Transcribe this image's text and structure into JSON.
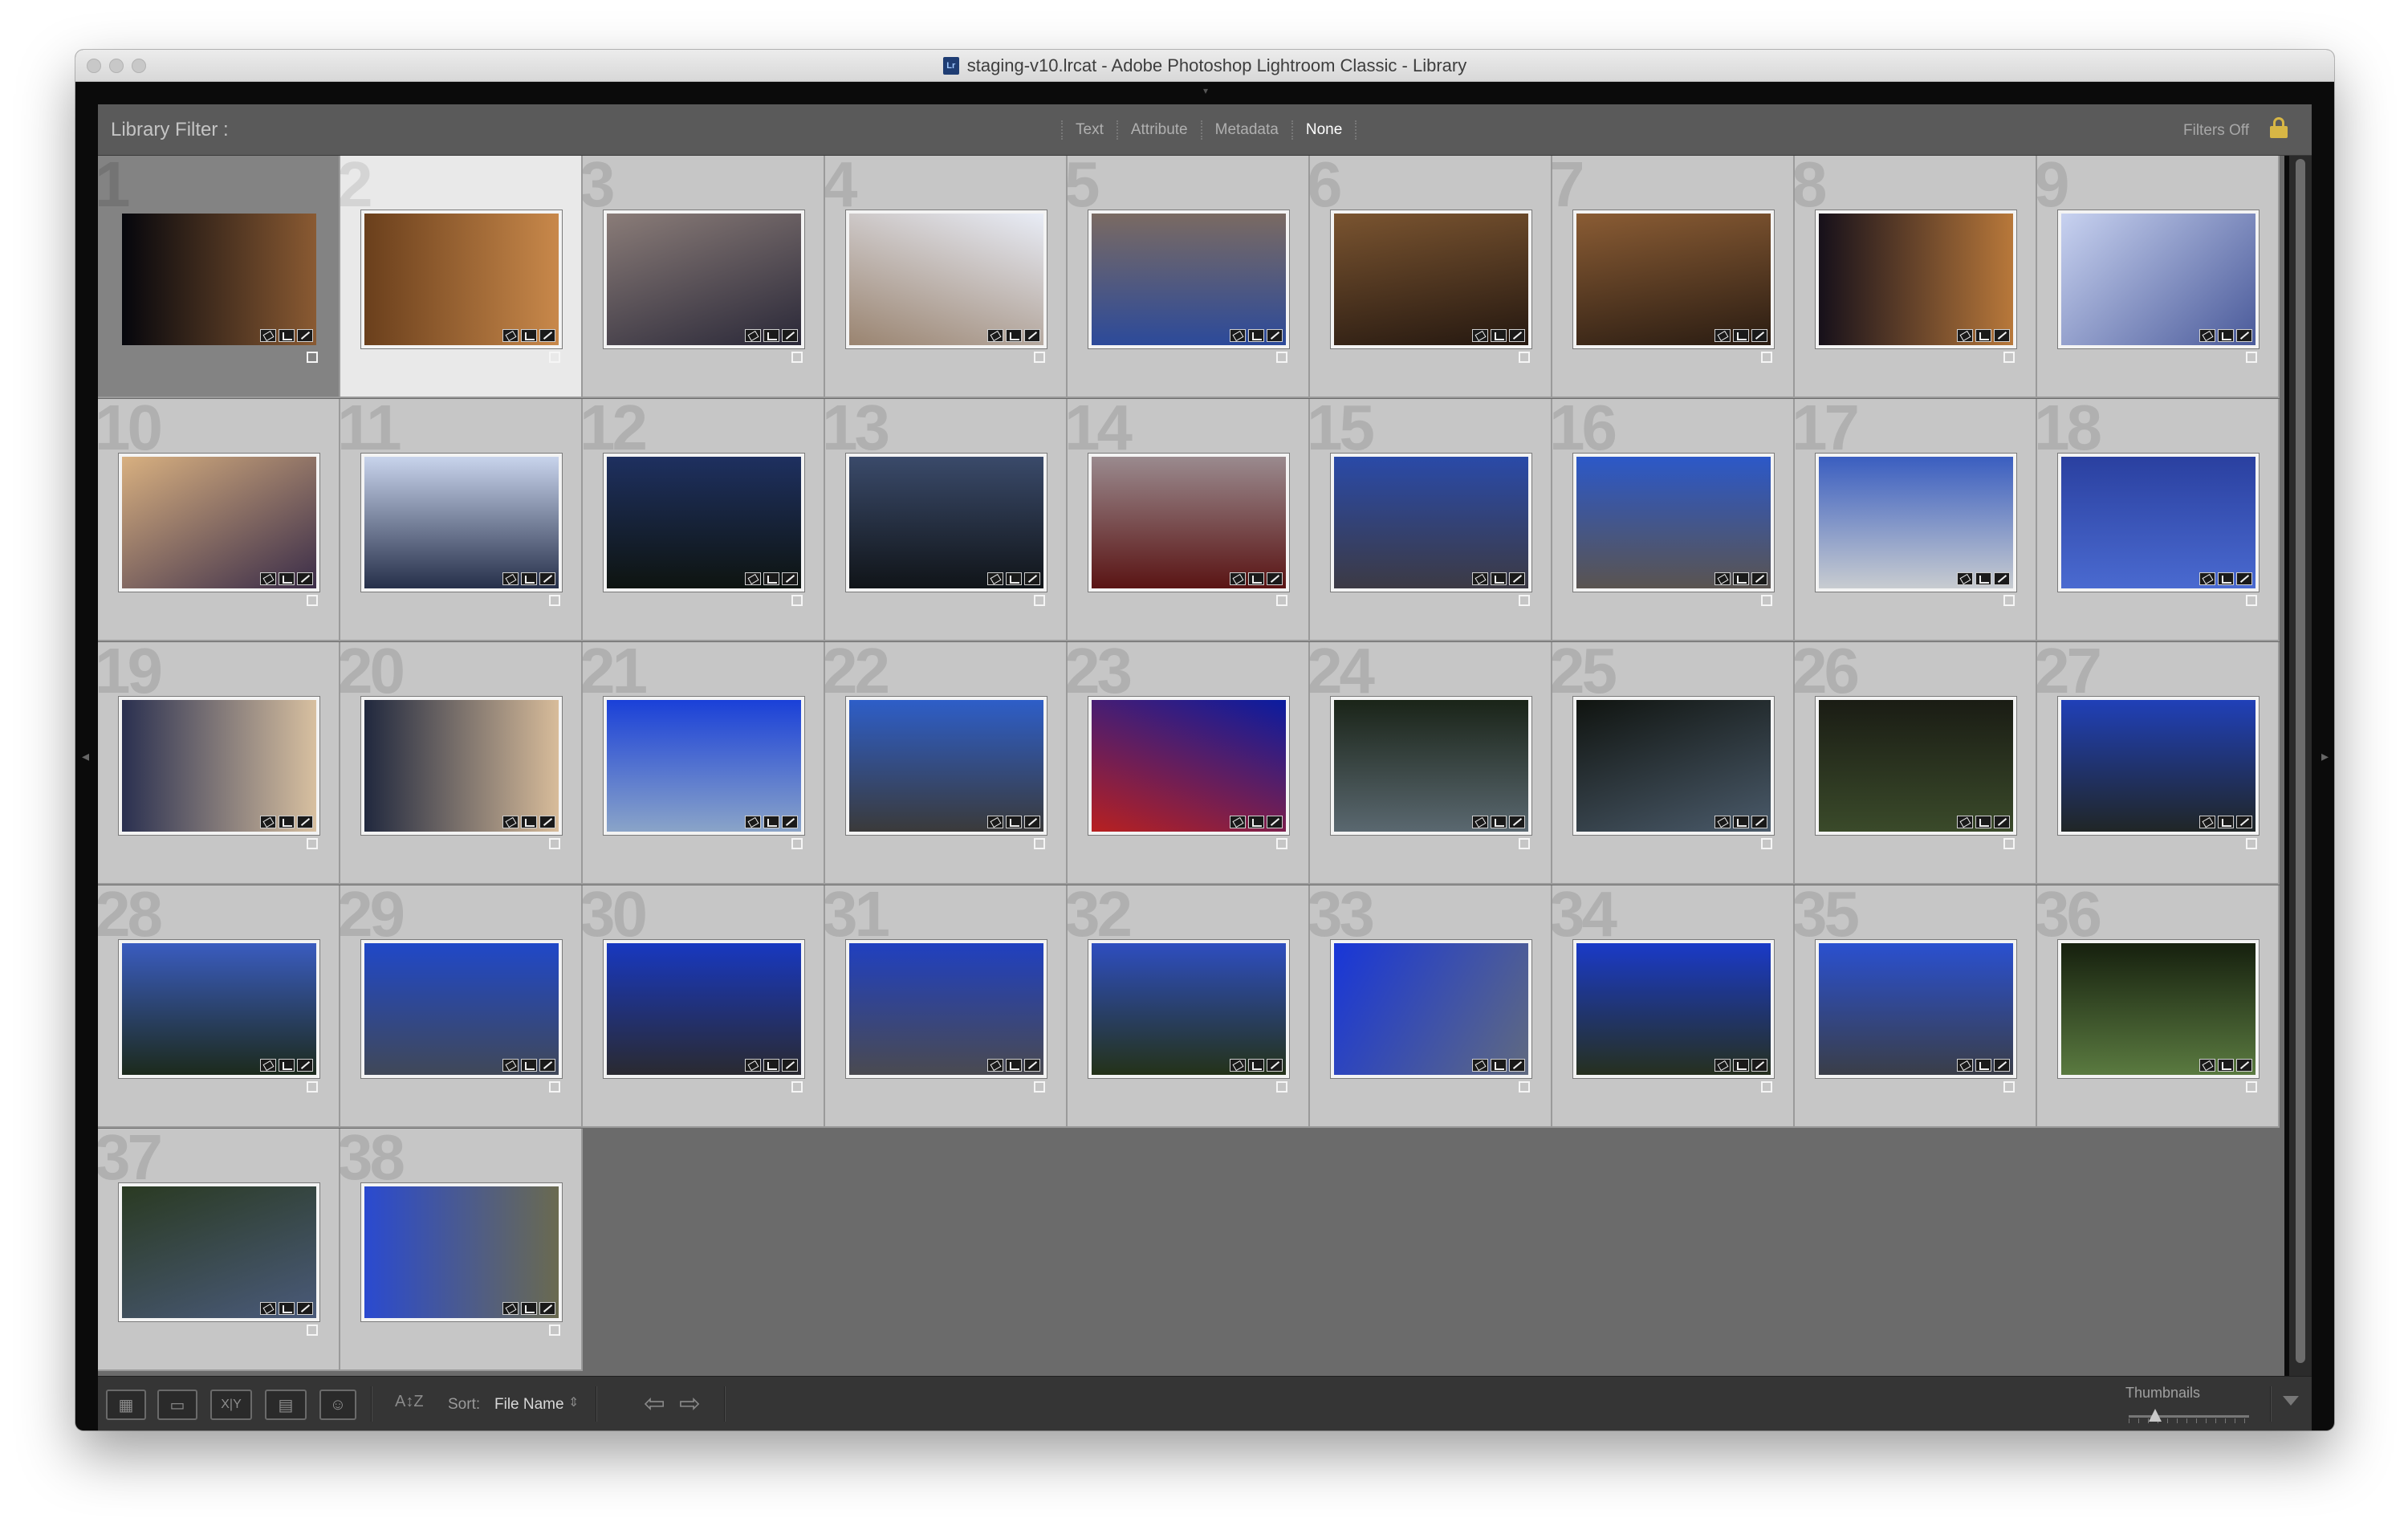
{
  "window": {
    "title": "staging-v10.lrcat - Adobe Photoshop Lightroom Classic - Library",
    "icon": "lightroom-catalog-icon",
    "doc_icon_text": "Lr"
  },
  "filter_bar": {
    "label": "Library Filter :",
    "tabs": [
      "Text",
      "Attribute",
      "Metadata",
      "None"
    ],
    "active_tab": "None",
    "filters_status": "Filters Off",
    "lock_icon": "lock-icon",
    "colors": {
      "lock": "#d7b645"
    }
  },
  "grid": {
    "selected_index": 2,
    "current_index": 1,
    "cells": [
      {
        "num": "1",
        "c1": "#05060c",
        "c2": "#8a5a32",
        "angle": 90
      },
      {
        "num": "2",
        "c1": "#6a3f1c",
        "c2": "#c8884a",
        "angle": 90
      },
      {
        "num": "3",
        "c1": "#8a7c78",
        "c2": "#2a2838",
        "angle": 160
      },
      {
        "num": "4",
        "c1": "#e8ecf6",
        "c2": "#9a8470",
        "angle": 200
      },
      {
        "num": "5",
        "c1": "#7a6a62",
        "c2": "#2c4a9a",
        "angle": 180
      },
      {
        "num": "6",
        "c1": "#7a5430",
        "c2": "#251810",
        "angle": 170
      },
      {
        "num": "7",
        "c1": "#8a5c34",
        "c2": "#2a1c12",
        "angle": 170
      },
      {
        "num": "8",
        "c1": "#16101a",
        "c2": "#b8783a",
        "angle": 90
      },
      {
        "num": "9",
        "c1": "#c8d2f0",
        "c2": "#4a5a9a",
        "angle": 135
      },
      {
        "num": "10",
        "c1": "#d8b080",
        "c2": "#3a2c48",
        "angle": 150
      },
      {
        "num": "11",
        "c1": "#c8d4ec",
        "c2": "#26304a",
        "angle": 180
      },
      {
        "num": "12",
        "c1": "#1e3060",
        "c2": "#0e1410",
        "angle": 180
      },
      {
        "num": "13",
        "c1": "#3a4a6a",
        "c2": "#101418",
        "angle": 180
      },
      {
        "num": "14",
        "c1": "#9a8a8e",
        "c2": "#5a1414",
        "angle": 180
      },
      {
        "num": "15",
        "c1": "#2a4aa8",
        "c2": "#3c3a44",
        "angle": 180
      },
      {
        "num": "16",
        "c1": "#2c58c8",
        "c2": "#5a5450",
        "angle": 180
      },
      {
        "num": "17",
        "c1": "#3a5ec0",
        "c2": "#c8ccd0",
        "angle": 180
      },
      {
        "num": "18",
        "c1": "#2a40a0",
        "c2": "#4a6ad0",
        "angle": 180
      },
      {
        "num": "19",
        "c1": "#2a3050",
        "c2": "#d8c0a0",
        "angle": 90
      },
      {
        "num": "20",
        "c1": "#20283e",
        "c2": "#d8bc9a",
        "angle": 90
      },
      {
        "num": "21",
        "c1": "#1a40d8",
        "c2": "#8aa4c8",
        "angle": 180
      },
      {
        "num": "22",
        "c1": "#2e5ec8",
        "c2": "#3a3a3a",
        "angle": 180
      },
      {
        "num": "23",
        "c1": "#0a1ca0",
        "c2": "#b82020",
        "angle": 200
      },
      {
        "num": "24",
        "c1": "#1a2418",
        "c2": "#5a6870",
        "angle": 180
      },
      {
        "num": "25",
        "c1": "#101410",
        "c2": "#4a5a6a",
        "angle": 160
      },
      {
        "num": "26",
        "c1": "#1a1c14",
        "c2": "#3a4a2a",
        "angle": 180
      },
      {
        "num": "27",
        "c1": "#2040b8",
        "c2": "#202626",
        "angle": 180
      },
      {
        "num": "28",
        "c1": "#3a5cc0",
        "c2": "#1c2a1c",
        "angle": 180
      },
      {
        "num": "29",
        "c1": "#2048c8",
        "c2": "#404858",
        "angle": 180
      },
      {
        "num": "30",
        "c1": "#1838c0",
        "c2": "#2a2a30",
        "angle": 180
      },
      {
        "num": "31",
        "c1": "#2040c0",
        "c2": "#4a4a50",
        "angle": 180
      },
      {
        "num": "32",
        "c1": "#2e4ec0",
        "c2": "#243218",
        "angle": 180
      },
      {
        "num": "33",
        "c1": "#1836d8",
        "c2": "#606a80",
        "angle": 120
      },
      {
        "num": "34",
        "c1": "#1a3ac8",
        "c2": "#26301e",
        "angle": 180
      },
      {
        "num": "35",
        "c1": "#2a50d0",
        "c2": "#3a3e48",
        "angle": 180
      },
      {
        "num": "36",
        "c1": "#16200e",
        "c2": "#5a7a40",
        "angle": 180
      },
      {
        "num": "37",
        "c1": "#2a3a22",
        "c2": "#4a5a7a",
        "angle": 160
      },
      {
        "num": "38",
        "c1": "#2a4ad0",
        "c2": "#6a6a50",
        "angle": 90
      }
    ]
  },
  "toolbar": {
    "view_buttons": [
      {
        "name": "grid-view-icon",
        "glyph": "▦"
      },
      {
        "name": "loupe-view-icon",
        "glyph": "▭"
      },
      {
        "name": "compare-view-icon",
        "glyph": "X|Y"
      },
      {
        "name": "survey-view-icon",
        "glyph": "▤"
      },
      {
        "name": "people-view-icon",
        "glyph": "☺"
      }
    ],
    "sort_direction_glyph": "A↕Z",
    "sort_label": "Sort:",
    "sort_value": "File Name",
    "sort_caret": "⇕",
    "prev_arrow": "⇦",
    "next_arrow": "⇨",
    "thumbnails_label": "Thumbnails",
    "thumbnail_size": 0.22
  }
}
